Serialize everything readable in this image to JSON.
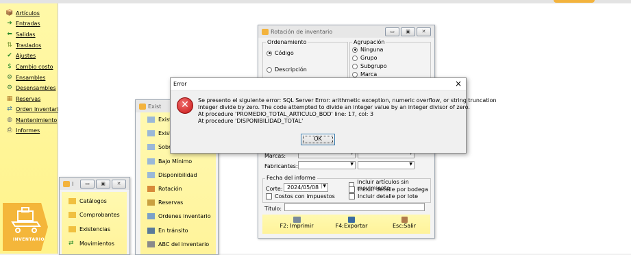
{
  "sidebar": {
    "items": [
      {
        "label": "Artículos",
        "icon": "box-icon"
      },
      {
        "label": "Entradas",
        "icon": "arrow-right-icon"
      },
      {
        "label": "Salidas",
        "icon": "arrow-left-icon"
      },
      {
        "label": "Traslados",
        "icon": "transfer-icon"
      },
      {
        "label": "Ajustes",
        "icon": "check-icon"
      },
      {
        "label": "Cambio costo",
        "icon": "dollar-icon"
      },
      {
        "label": "Ensambles",
        "icon": "assembly-icon"
      },
      {
        "label": "Desensambles",
        "icon": "disassembly-icon"
      },
      {
        "label": "Reservas",
        "icon": "reserve-icon"
      },
      {
        "label": "Orden inventario",
        "icon": "order-icon"
      },
      {
        "label": "Mantenimiento",
        "icon": "maintenance-icon"
      },
      {
        "label": "Informes",
        "icon": "printer-icon"
      }
    ],
    "module_label": "INVENTARIO"
  },
  "win_small": {
    "title": "I",
    "items": [
      "Catálogos",
      "Comprobantes",
      "Existencias",
      "Movimientos"
    ]
  },
  "win_exist": {
    "title": "Exist",
    "items": [
      "Exist",
      "Exist",
      "Sobre",
      "Bajo Mínimo",
      "Disponibilidad",
      "Rotación",
      "Reservas",
      "Ordenes inventario",
      "En tránsito",
      "ABC del inventario"
    ]
  },
  "win_rot": {
    "title": "Rotación de inventario",
    "ordenamiento_label": "Ordenamiento",
    "orden_options": [
      "Código",
      "Descripción"
    ],
    "agrupacion_label": "Agrupación",
    "agrup_options": [
      "Ninguna",
      "Grupo",
      "Subgrupo",
      "Marca"
    ],
    "marcas_label": "Marcas:",
    "fabricantes_label": "Fabricantes:",
    "fecha_label": "Fecha del informe",
    "corte_label": "Corte:",
    "corte_value": "2024/05/08",
    "costos_label": "Costos con impuestos",
    "checks": [
      "Incluir artículos sin movimiento",
      "Incluir detalle por bodega",
      "Incluir detalle por lote"
    ],
    "titulo_label": "Título:",
    "btn_print": "F2: Imprimir",
    "btn_export": "F4:Exportar",
    "btn_exit": "Esc:Salir"
  },
  "dialog": {
    "title": "Error",
    "close": "×",
    "message": [
      "Se presento el siguiente error: SQL Server Error: arithmetic exception, numeric overflow, or string truncation",
      "Integer divide by zero.  The code attempted to divide an integer value by an integer divisor of zero.",
      "At procedure 'PROMEDIO_TOTAL_ARTICULO_BOD' line: 17, col: 3",
      "At procedure 'DISPONIBILIDAD_TOTAL'"
    ],
    "ok": "OK"
  },
  "colors": {
    "sidebar": "#fff38a",
    "accent": "#f3b33d",
    "error": "#c81414"
  }
}
